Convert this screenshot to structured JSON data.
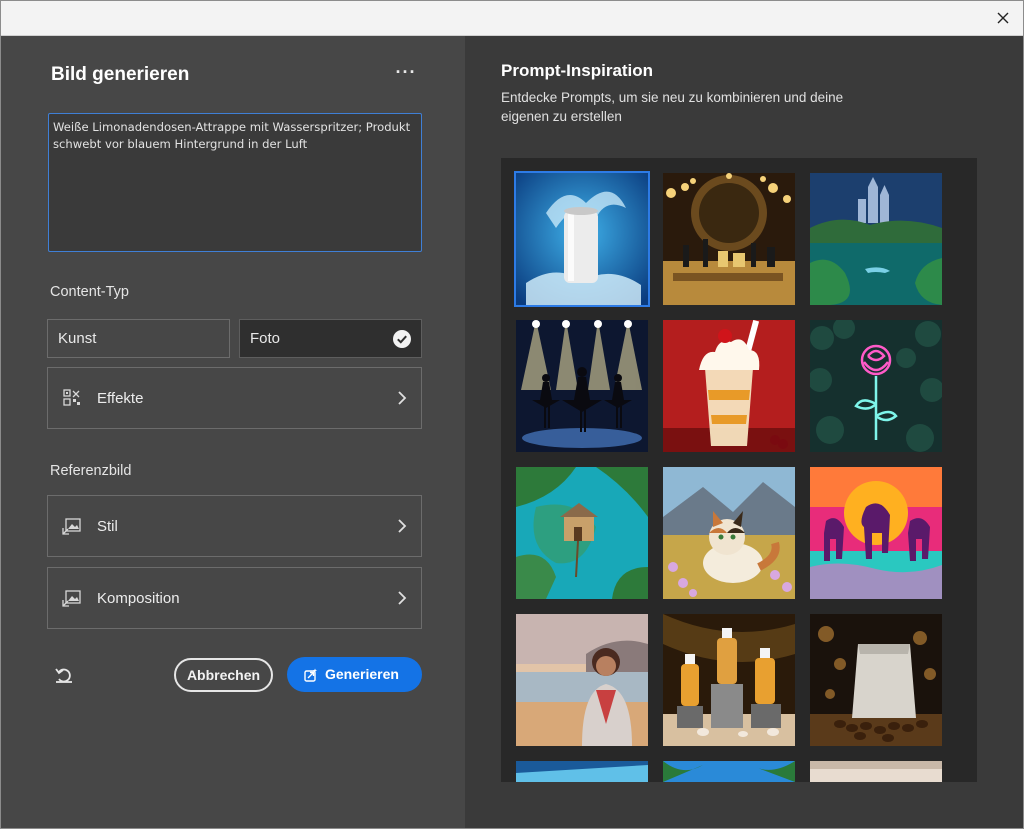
{
  "window": {
    "close_label": "×"
  },
  "left": {
    "title": "Bild generieren",
    "more_label": "···",
    "prompt_text": "Weiße Limonadendosen-Attrappe mit Wasserspritzer; Produkt schwebt vor blauem Hintergrund in der Luft",
    "content_type_label": "Content-Typ",
    "type_options": [
      {
        "label": "Kunst",
        "selected": false
      },
      {
        "label": "Foto",
        "selected": true
      }
    ],
    "effects_label": "Effekte",
    "reference_label": "Referenzbild",
    "style_label": "Stil",
    "composition_label": "Komposition",
    "cancel_label": "Abbrechen",
    "generate_label": "Generieren"
  },
  "right": {
    "title": "Prompt-Inspiration",
    "description": "Entdecke Prompts, um sie neu zu kombinieren und deine eigenen zu erstellen",
    "gallery": [
      {
        "name": "soda-can-splash",
        "selected": true
      },
      {
        "name": "cosmetics-vanity",
        "selected": false
      },
      {
        "name": "fantasy-castle-lake",
        "selected": false
      },
      {
        "name": "ballet-dancers",
        "selected": false
      },
      {
        "name": "milkshake",
        "selected": false
      },
      {
        "name": "neon-rose",
        "selected": false
      },
      {
        "name": "floating-house-island",
        "selected": false
      },
      {
        "name": "fluffy-cat-meadow",
        "selected": false
      },
      {
        "name": "neon-horses",
        "selected": false
      },
      {
        "name": "woman-beach-sunset",
        "selected": false
      },
      {
        "name": "cosmetic-bottles-shells",
        "selected": false
      },
      {
        "name": "coffee-bag-beans",
        "selected": false
      }
    ]
  },
  "colors": {
    "accent": "#1473e6",
    "panel": "#474747",
    "background": "#3a3a3a"
  }
}
